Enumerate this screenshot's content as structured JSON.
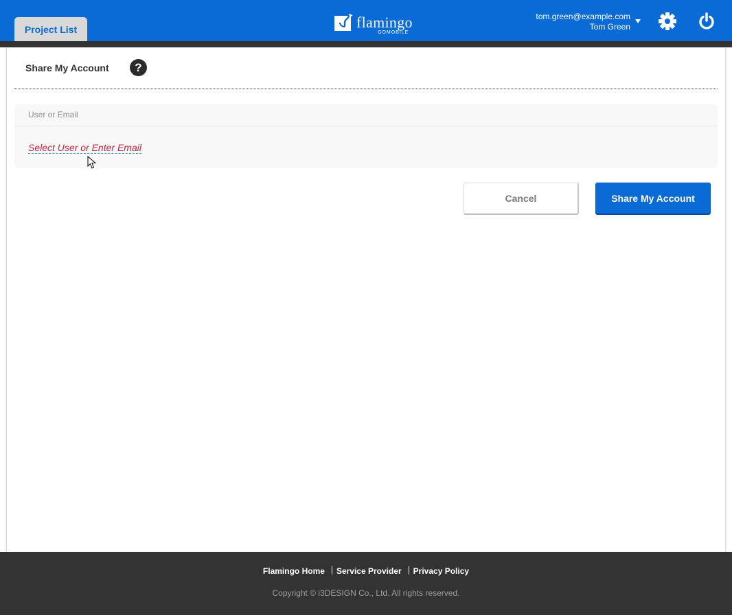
{
  "header": {
    "tab_label": "Project List",
    "logo_text": "flamingo",
    "logo_subtext": "GOMOBILE",
    "user_email": "tom.green@example.com",
    "user_name": "Tom Green",
    "icons": {
      "settings": "gear-icon",
      "logout": "power-icon",
      "user_menu": "caret-down-icon"
    },
    "colors": {
      "bar": "#0a6ad6",
      "strip": "#333333"
    }
  },
  "page": {
    "title": "Share My Account",
    "help_symbol": "?"
  },
  "form": {
    "field_label": "User or Email",
    "field_placeholder": "Select User or Enter Email",
    "placeholder_color": "#c8273f"
  },
  "actions": {
    "cancel_label": "Cancel",
    "share_label": "Share My Account",
    "primary_color": "#0a6ad6"
  },
  "footer": {
    "links": [
      "Flamingo Home",
      "Service Provider",
      "Privacy Policy"
    ],
    "copyright": "Copyright © i3DESIGN Co., Ltd. All rights reserved."
  }
}
